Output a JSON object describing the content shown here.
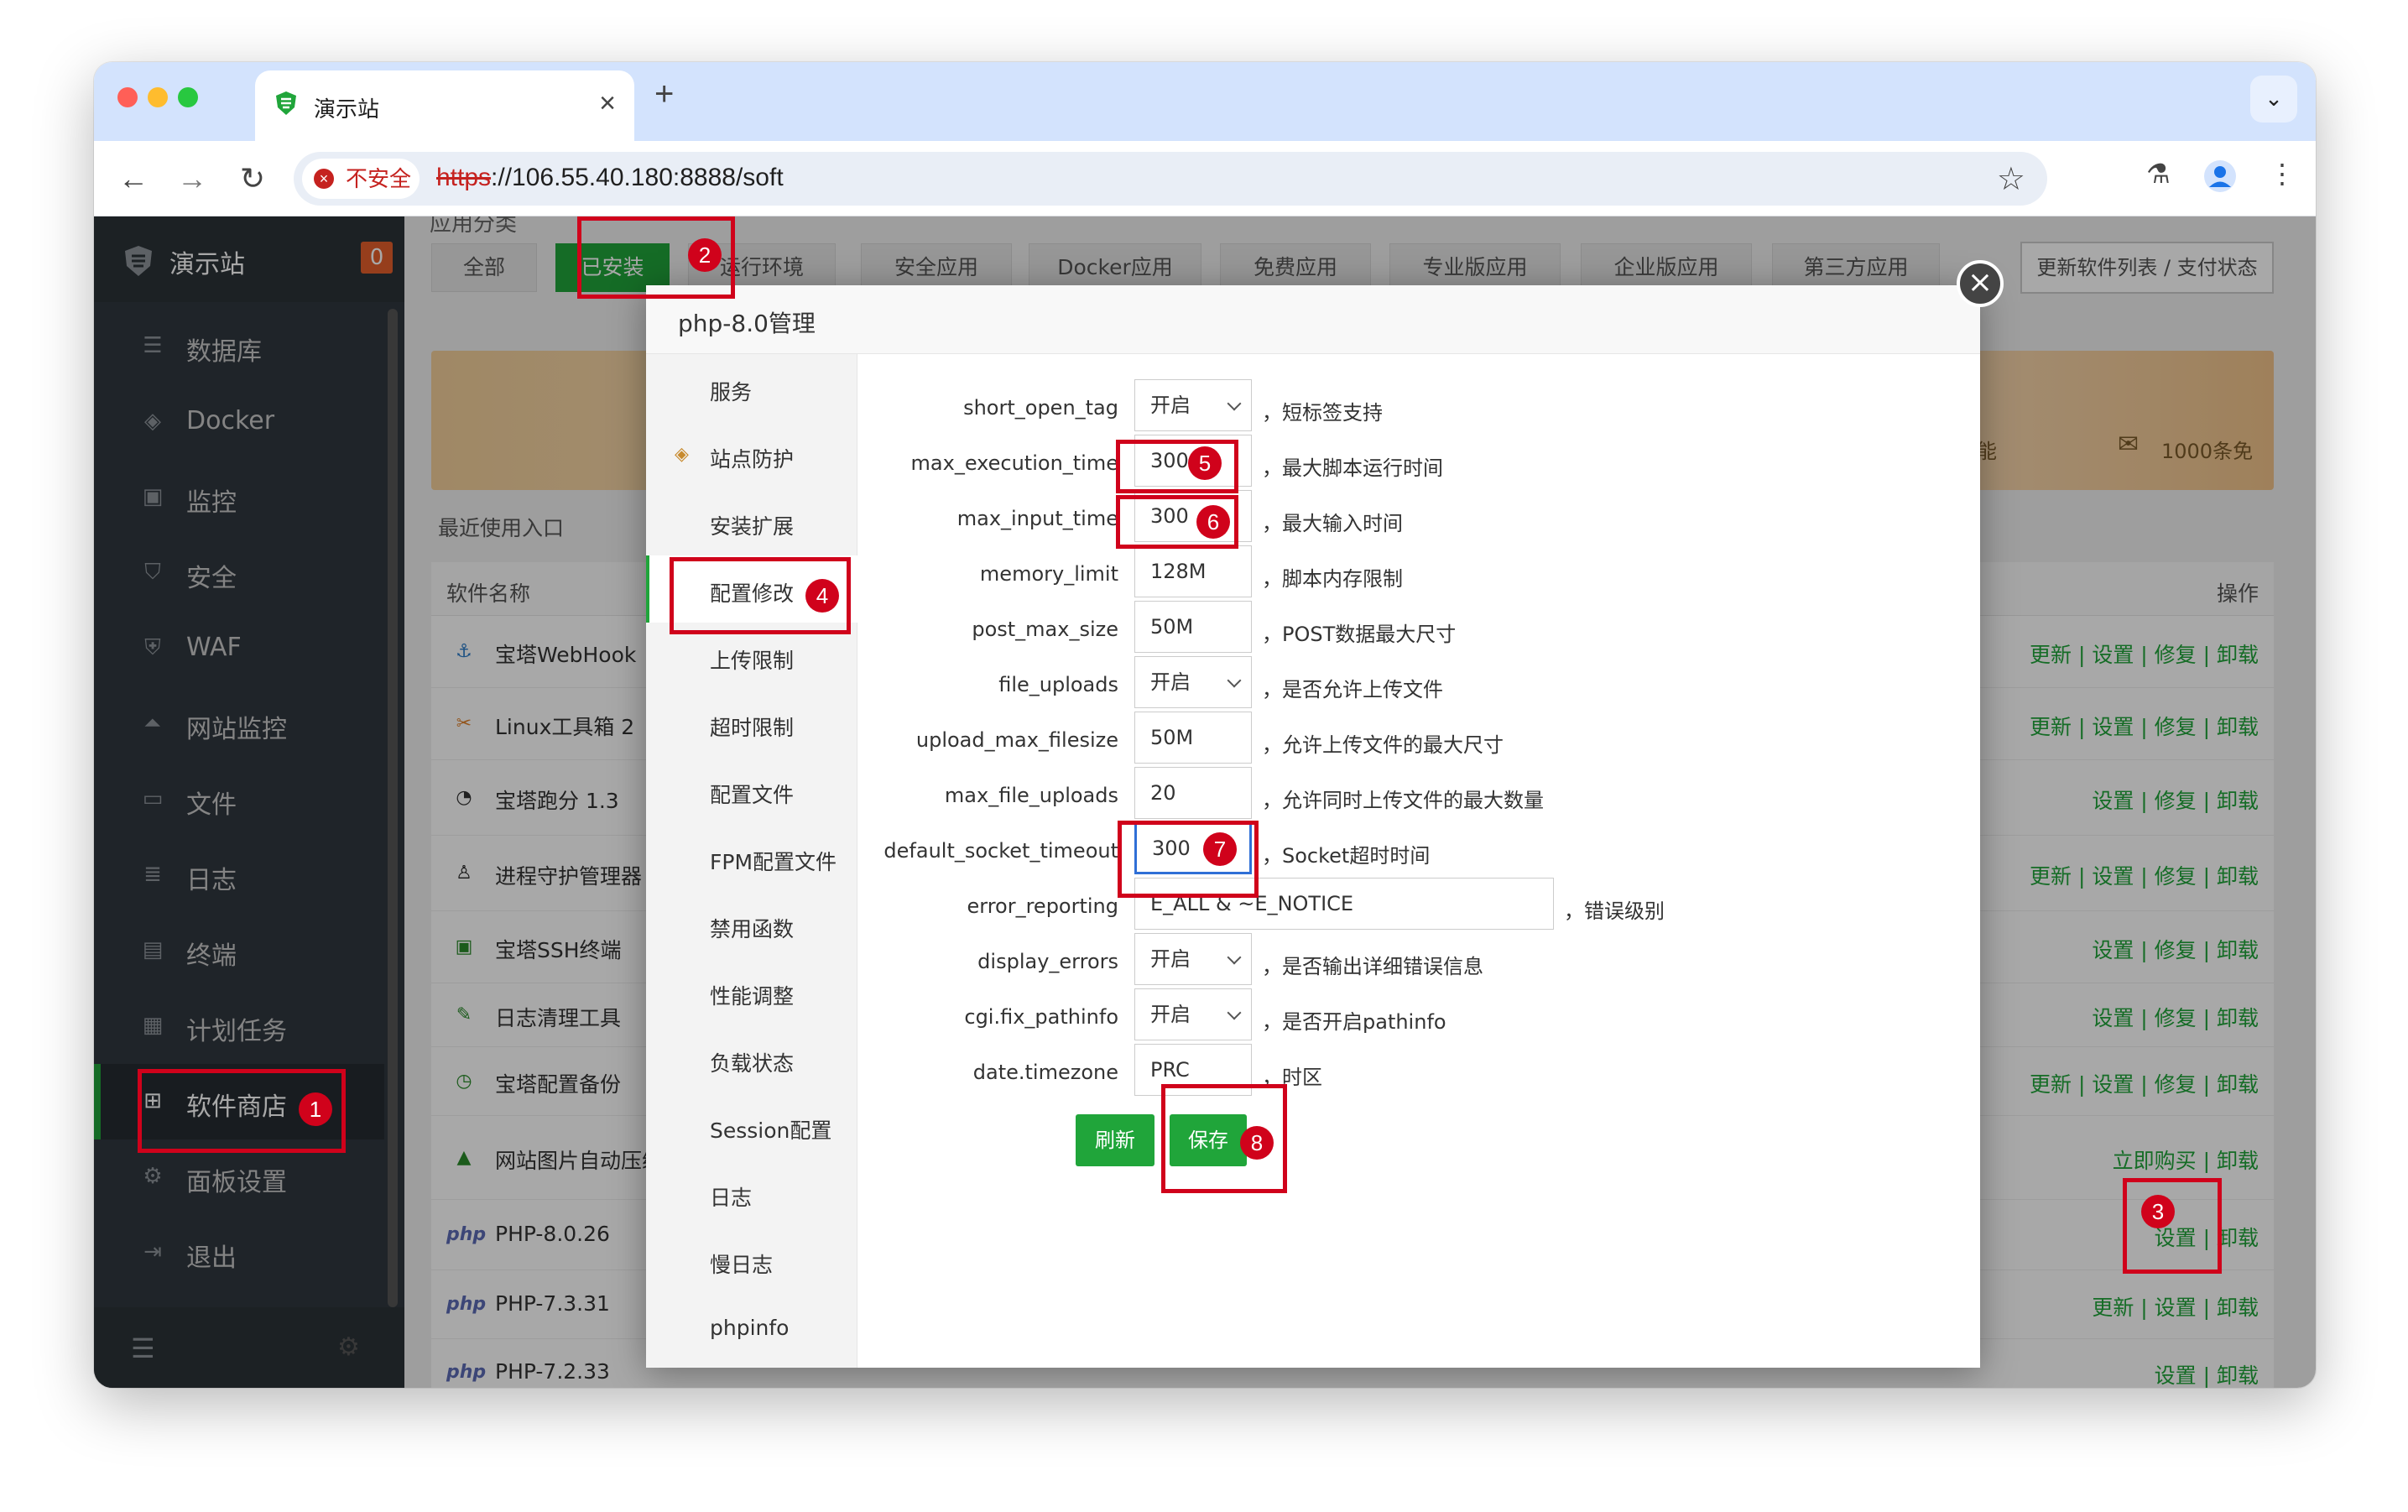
{
  "browser": {
    "tab_title": "演示站",
    "tab_close": "×",
    "new_tab": "+",
    "tab_dropdown": "⌄",
    "security_label": "不安全",
    "url_scheme": "https",
    "url_rest": "://106.55.40.180:8888/soft"
  },
  "sidebar": {
    "brand": "演示站",
    "badge": "0",
    "items": [
      {
        "label": "数据库",
        "icon": "database-icon"
      },
      {
        "label": "Docker",
        "icon": "docker-icon"
      },
      {
        "label": "监控",
        "icon": "monitor-icon"
      },
      {
        "label": "安全",
        "icon": "shield-icon"
      },
      {
        "label": "WAF",
        "icon": "waf-icon"
      },
      {
        "label": "网站监控",
        "icon": "site-monitor-icon"
      },
      {
        "label": "文件",
        "icon": "folder-icon"
      },
      {
        "label": "日志",
        "icon": "log-icon"
      },
      {
        "label": "终端",
        "icon": "terminal-icon"
      },
      {
        "label": "计划任务",
        "icon": "calendar-icon"
      },
      {
        "label": "软件商店",
        "icon": "grid-icon",
        "active": true
      },
      {
        "label": "面板设置",
        "icon": "gear-icon"
      },
      {
        "label": "退出",
        "icon": "logout-icon"
      }
    ]
  },
  "main": {
    "category_title": "应用分类",
    "categories": [
      "全部",
      "已安装",
      "运行环境",
      "安全应用",
      "Docker应用",
      "免费应用",
      "专业版应用",
      "企业版应用",
      "第三方应用"
    ],
    "active_category": "已安装",
    "update_button": "更新软件列表 / 支付状态",
    "banner_text_1": "专享功能",
    "banner_text_2": "1000条免",
    "recent_label": "最近使用入口",
    "table_header_name": "软件名称",
    "table_header_ops": "操作",
    "rows": [
      {
        "name": "宝塔WebHook",
        "ops": "更新 | 设置 | 修复 | 卸载",
        "icon": "anchor-icon"
      },
      {
        "name": "Linux工具箱 2",
        "ops": "更新 | 设置 | 修复 | 卸载",
        "icon": "tools-icon"
      },
      {
        "name": "宝塔跑分 1.3",
        "ops": "设置 | 修复 | 卸载",
        "icon": "gauge-icon"
      },
      {
        "name": "进程守护管理器",
        "ops": "更新 | 设置 | 修复 | 卸载",
        "icon": "linux-icon"
      },
      {
        "name": "宝塔SSH终端",
        "ops": "设置 | 修复 | 卸载",
        "icon": "terminal-icon"
      },
      {
        "name": "日志清理工具",
        "ops": "设置 | 修复 | 卸载",
        "icon": "broom-icon"
      },
      {
        "name": "宝塔配置备份",
        "ops": "更新 | 设置 | 修复 | 卸载",
        "icon": "backup-icon"
      },
      {
        "name": "网站图片自动压缩",
        "ops": "立即购买 | 卸载",
        "icon": "image-icon"
      },
      {
        "name": "PHP-8.0.26",
        "ops": "设置 | 卸载",
        "icon": "php-icon",
        "icon_text": "php"
      },
      {
        "name": "PHP-7.3.31",
        "ops": "更新 | 设置 | 卸载",
        "icon": "php-icon",
        "icon_text": "php"
      },
      {
        "name": "PHP-7.2.33",
        "ops": "设置 | 卸载",
        "icon": "php-icon",
        "icon_text": "php"
      }
    ]
  },
  "modal": {
    "title": "php-8.0管理",
    "close": "×",
    "menu": [
      "服务",
      "站点防护",
      "安装扩展",
      "配置修改",
      "上传限制",
      "超时限制",
      "配置文件",
      "FPM配置文件",
      "禁用函数",
      "性能调整",
      "负载状态",
      "Session配置",
      "日志",
      "慢日志",
      "phpinfo"
    ],
    "active_menu": "配置修改",
    "settings": [
      {
        "key": "short_open_tag",
        "value": "开启",
        "type": "select",
        "desc": "，短标签支持"
      },
      {
        "key": "max_execution_time",
        "value": "300",
        "type": "input",
        "desc": "，最大脚本运行时间"
      },
      {
        "key": "max_input_time",
        "value": "300",
        "type": "input",
        "desc": "，最大输入时间"
      },
      {
        "key": "memory_limit",
        "value": "128M",
        "type": "input",
        "desc": "，脚本内存限制"
      },
      {
        "key": "post_max_size",
        "value": "50M",
        "type": "input",
        "desc": "，POST数据最大尺寸"
      },
      {
        "key": "file_uploads",
        "value": "开启",
        "type": "select",
        "desc": "，是否允许上传文件"
      },
      {
        "key": "upload_max_filesize",
        "value": "50M",
        "type": "input",
        "desc": "，允许上传文件的最大尺寸"
      },
      {
        "key": "max_file_uploads",
        "value": "20",
        "type": "input",
        "desc": "，允许同时上传文件的最大数量"
      },
      {
        "key": "default_socket_timeout",
        "value": "300",
        "type": "input",
        "desc": "，Socket超时时间"
      },
      {
        "key": "error_reporting",
        "value": "E_ALL & ~E_NOTICE",
        "type": "input-wide",
        "desc": "，错误级别"
      },
      {
        "key": "display_errors",
        "value": "开启",
        "type": "select",
        "desc": "，是否输出详细错误信息"
      },
      {
        "key": "cgi.fix_pathinfo",
        "value": "开启",
        "type": "select",
        "desc": "，是否开启pathinfo"
      },
      {
        "key": "date.timezone",
        "value": "PRC",
        "type": "input",
        "desc": "，时区"
      }
    ],
    "refresh_button": "刷新",
    "save_button": "保存"
  },
  "annotations": [
    "1",
    "2",
    "3",
    "4",
    "5",
    "6",
    "7",
    "8"
  ],
  "colors": {
    "accent": "#20a53a",
    "annotation": "#d0021b",
    "sidebar": "#30373f",
    "tabstrip": "#d3e3fd"
  }
}
